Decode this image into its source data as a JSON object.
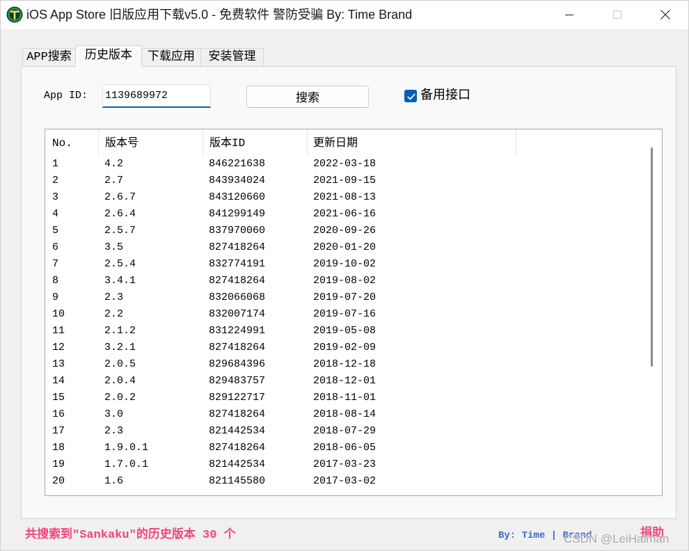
{
  "window": {
    "title": "iOS App Store 旧版应用下载v5.0 - 免费软件 警防受骗 By: Time Brand",
    "icons": {
      "app": "app-logo-icon",
      "minimize": "minimize-icon",
      "maximize": "maximize-icon",
      "close": "close-icon"
    },
    "maximize_enabled": false
  },
  "tabs": [
    {
      "label": "APP搜索",
      "selected": false
    },
    {
      "label": "历史版本",
      "selected": true
    },
    {
      "label": "下载应用",
      "selected": false
    },
    {
      "label": "安装管理",
      "selected": false
    }
  ],
  "search": {
    "app_id_label": "App ID:",
    "app_id_value": "1139689972",
    "search_button_label": "搜索",
    "backup_api_label": "备用接口",
    "backup_api_checked": true,
    "checkbox_icon": "checkmark-icon"
  },
  "table": {
    "columns": [
      "No.",
      "版本号",
      "版本ID",
      "更新日期"
    ],
    "rows": [
      {
        "no": "1",
        "version": "4.2",
        "version_id": "846221638",
        "date": "2022-03-18"
      },
      {
        "no": "2",
        "version": "2.7",
        "version_id": "843934024",
        "date": "2021-09-15"
      },
      {
        "no": "3",
        "version": "2.6.7",
        "version_id": "843120660",
        "date": "2021-08-13"
      },
      {
        "no": "4",
        "version": "2.6.4",
        "version_id": "841299149",
        "date": "2021-06-16"
      },
      {
        "no": "5",
        "version": "2.5.7",
        "version_id": "837970060",
        "date": "2020-09-26"
      },
      {
        "no": "6",
        "version": "3.5",
        "version_id": "827418264",
        "date": "2020-01-20"
      },
      {
        "no": "7",
        "version": "2.5.4",
        "version_id": "832774191",
        "date": "2019-10-02"
      },
      {
        "no": "8",
        "version": "3.4.1",
        "version_id": "827418264",
        "date": "2019-08-02"
      },
      {
        "no": "9",
        "version": "2.3",
        "version_id": "832066068",
        "date": "2019-07-20"
      },
      {
        "no": "10",
        "version": "2.2",
        "version_id": "832007174",
        "date": "2019-07-16"
      },
      {
        "no": "11",
        "version": "2.1.2",
        "version_id": "831224991",
        "date": "2019-05-08"
      },
      {
        "no": "12",
        "version": "3.2.1",
        "version_id": "827418264",
        "date": "2019-02-09"
      },
      {
        "no": "13",
        "version": "2.0.5",
        "version_id": "829684396",
        "date": "2018-12-18"
      },
      {
        "no": "14",
        "version": "2.0.4",
        "version_id": "829483757",
        "date": "2018-12-01"
      },
      {
        "no": "15",
        "version": "2.0.2",
        "version_id": "829122717",
        "date": "2018-11-01"
      },
      {
        "no": "16",
        "version": "3.0",
        "version_id": "827418264",
        "date": "2018-08-14"
      },
      {
        "no": "17",
        "version": "2.3",
        "version_id": "821442534",
        "date": "2018-07-29"
      },
      {
        "no": "18",
        "version": "1.9.0.1",
        "version_id": "827418264",
        "date": "2018-06-05"
      },
      {
        "no": "19",
        "version": "1.7.0.1",
        "version_id": "821442534",
        "date": "2017-03-23"
      },
      {
        "no": "20",
        "version": "1.6",
        "version_id": "821145580",
        "date": "2017-03-02"
      }
    ]
  },
  "status": {
    "summary": "共搜索到\"Sankaku\"的历史版本 30 个",
    "author_prefix": "By:",
    "author_time": "Time",
    "author_separator": "|",
    "author_brand": "Brand",
    "donate": "捐助"
  },
  "watermark": "CSDN @LeiHaiman",
  "colors": {
    "accent": "#005fb8",
    "status_text": "#f0457e",
    "link_text": "#3a6ad9",
    "app_icon_green": "#1f9a4a"
  }
}
